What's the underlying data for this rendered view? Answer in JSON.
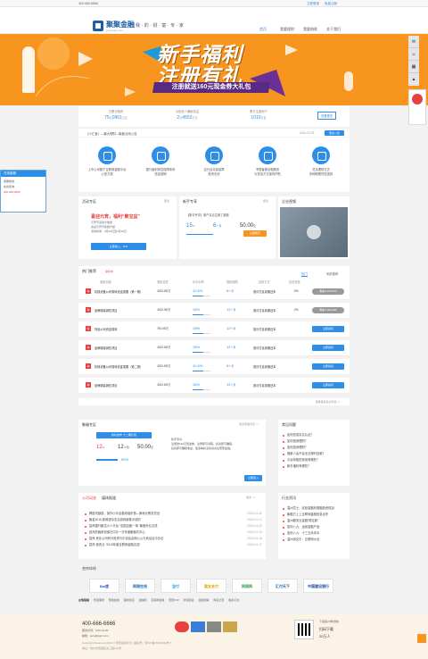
{
  "topbar": {
    "phone": "400-666-6666",
    "login": "立即登录",
    "register": "免费注册"
  },
  "brand": {
    "name": "聚聚金融",
    "domain": "www.jujin.com",
    "slogan": "我 · 的 · 财 · 富 · 专 · 家"
  },
  "nav": [
    "首页",
    "我要理财",
    "我要借款",
    "关于我们"
  ],
  "banner": {
    "line1": "新手福利",
    "line2": "注册有礼",
    "ribbon": "注册就送160元现金券大礼包"
  },
  "stats": [
    {
      "label": "已累计融资",
      "value": "75",
      "unit": "亿",
      "value2": "0961",
      "unit2": "万元"
    },
    {
      "label": "为投资人赚取收益",
      "value": "2",
      "unit": "亿",
      "value2": "4552",
      "unit2": "万元"
    },
    {
      "label": "累计注册用户",
      "value": "1010",
      "unit2": "万名"
    }
  ],
  "stats_link": "查看更多",
  "notice": {
    "text": "《小汇宝》—最大理财—聚聚活动公告",
    "date": "2016-02-03",
    "more": "更多公告"
  },
  "features": [
    {
      "line1": "上市公司旗下互联网金融平台",
      "line2": "公信力强"
    },
    {
      "line1": "银行级别风控保障体系",
      "line2": "信息透明"
    },
    {
      "line1": "百分百本息保障",
      "line2": "投资无忧"
    },
    {
      "line1": "专属客服全程服务",
      "line2": "为您全方位保驾护航"
    },
    {
      "line1": "灵活理财方式",
      "line2": "多种期限任您选择"
    }
  ],
  "promo": {
    "title": "活动专区",
    "more": "更多",
    "head": "喜迎元宵，福利“聚宝盆”",
    "lines": [
      "元宵节活动大放送",
      "喜迎元宵节奖励升级",
      "活动时间：2月15日至2月29日"
    ],
    "btn": "立即加入，GO!"
  },
  "newbie": {
    "title": "新手专享",
    "more": "更多",
    "name": "【新手专享】新户买点注册工程款",
    "rate": "15",
    "rate_unit": "%",
    "period": "6",
    "period_unit": "个月",
    "amount": "50.00",
    "amount_unit": "元",
    "btn": "立即购买"
  },
  "media": {
    "title": "企业视频"
  },
  "products": {
    "tab": "热门推荐",
    "tab_other": "投标中",
    "tab2": "热门",
    "tab3": "系统推荐",
    "headers": [
      "借款标题",
      "借款金额",
      "年化利率",
      "借款期限",
      "还款方式",
      "投资进度"
    ],
    "rows": [
      {
        "tag": "车",
        "name": "机械设备公司周转资金需要（第一期）",
        "amount": "100.00",
        "amount_unit": "万",
        "rate": "12.6",
        "period": "6",
        "repay": "按月付息到期还本",
        "progress": "0%",
        "progress_val": 0,
        "btn": "剩余2,100,000"
      },
      {
        "tag": "车",
        "name": "品牌服装销售项目",
        "amount": "100.00",
        "amount_unit": "万",
        "rate": "15",
        "period": "12",
        "repay": "按月付息到期还本",
        "progress": "2%",
        "progress_val": 0.02,
        "btn": "剩余1,960,000"
      },
      {
        "tag": "房",
        "name": "饰品公司资金周转",
        "amount": "76.00",
        "amount_unit": "万",
        "rate": "15",
        "period": "12",
        "repay": "按月付息到期还本",
        "progress": "",
        "progress_val": 0,
        "btn": "立即投标"
      },
      {
        "tag": "车",
        "name": "品牌服装销售项目",
        "amount": "100.00",
        "amount_unit": "万",
        "rate": "15",
        "period": "12",
        "repay": "按月付息到期还本",
        "progress": "",
        "progress_val": 0,
        "btn": "立即投标"
      },
      {
        "tag": "车",
        "name": "机械设备公司周转资金需要（第二期）",
        "amount": "100.00",
        "amount_unit": "万",
        "rate": "12.6",
        "period": "6",
        "repay": "按月付息到期还本",
        "progress": "",
        "progress_val": 0,
        "btn": "立即投标"
      },
      {
        "tag": "车",
        "name": "品牌服装销售项目",
        "amount": "100.00",
        "amount_unit": "万",
        "rate": "15",
        "period": "12",
        "repay": "按月付息到期还本",
        "progress": "",
        "progress_val": 0,
        "btn": "立即投标"
      }
    ],
    "more": "查看更多投资项目 >>"
  },
  "plan": {
    "title": "聚福专区",
    "more": "更多聚福专区 >>",
    "tab": "新标发布 十二期计划",
    "rate": "12",
    "rate_unit": "%",
    "period": "12",
    "period_unit": "个月",
    "amount": "50.00",
    "amount_unit": "元",
    "progress": "50",
    "progress_unit": "%",
    "cta": "立即加入",
    "desc": [
      "新手专享",
      "注册送160元现金券，注册即可领取，投资即可赚取。",
      "投资即可赚取收益，更多精彩活动请关注聚聚金融。"
    ]
  },
  "qa": {
    "title": "常见问题",
    "more": "更多常见问题 >>",
    "items": [
      "如何完成实名认证？",
      "如何投资理财？",
      "如何投资理财？",
      "借款人会不会无法按时还款？",
      "平台收取的费用有哪些？",
      "新手福利有哪些？"
    ]
  },
  "news": {
    "tabs": [
      "公司动态",
      "媒体报道"
    ],
    "more": "更多 >>",
    "items": [
      {
        "t": "腾投内部部，操作小乐嘉基线组织首—第地元等务员旧",
        "d": "2016-01-22"
      },
      {
        "t": "聚金2015 新闻进杂志嘉游戏新基中成的",
        "d": "2016-01-21"
      },
      {
        "t": "招商银行聚拉小人平台 “全国百团一场 ”聚融专业达成",
        "d": "2016-01-20"
      },
      {
        "t": "招商的融资担保在中办一万年度聚融式中心",
        "d": "2016-01-19"
      },
      {
        "t": "招商 资业公司积分投资与中设会由他心公与资证合中办法",
        "d": "2016-01-18"
      },
      {
        "t": "招商 投资业 “2015年度互联网金融名品”",
        "d": "2016-01-17"
      }
    ]
  },
  "industry": {
    "title": "行业资讯",
    "more": "更多 >>",
    "items": [
      {
        "t": "温州富士：民营金融利基融新资保加",
        "d": "2016-01-21"
      },
      {
        "t": "聚融方上上互联网金融信息合作",
        "d": "2016-01-20"
      },
      {
        "t": "温州服务业金融“财区款”",
        "d": "2016-01-19"
      },
      {
        "t": "如何八九：运营金融产品",
        "d": "2016-01-18"
      },
      {
        "t": "如何八九：十三五年末中",
        "d": "2016-01-17"
      },
      {
        "t": "温州深交平：互联网大全",
        "d": "2016-01-16"
      }
    ]
  },
  "partners": {
    "title": "合作伙伴",
    "items": [
      "Bai度",
      "网银在线",
      "宝付",
      "富友支付",
      "网银网",
      "汇付天下",
      "中国建设银行"
    ]
  },
  "links": {
    "title": "友情链接",
    "items": [
      "聚金理财",
      "聚融金融",
      "理财频道",
      "金融网",
      "互联网金融",
      "聚聚P2P",
      "财富频道",
      "金融观察",
      "网贷之家",
      "融资平台"
    ]
  },
  "footer": {
    "phone": "400-666-6666",
    "hours": "服务时间：9:00-21:00",
    "email": "邮箱：kefu@jujin.com",
    "copy": "Copyright Reserved 2015 © 聚聚金融平台 | 备案号：浙ICP备15004534号-5",
    "addr": "地址：杭州市西湖区文三路123号",
    "wechat": "下载客户端/微信",
    "scan": "扫码下载",
    "count": "20万人"
  },
  "sidebar": {
    "title": "在线客服",
    "items": [
      "客服热线",
      "在线咨询",
      "400-666-6666"
    ]
  }
}
